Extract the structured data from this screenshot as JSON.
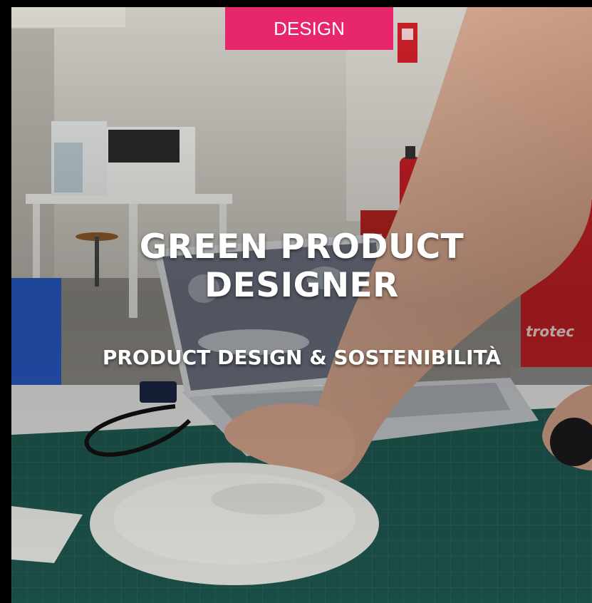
{
  "card": {
    "category": "DESIGN",
    "title_line1": "GREEN PRODUCT",
    "title_line2": "DESIGNER",
    "subtitle": "PRODUCT DESIGN & SOSTENIBILITÀ",
    "photo_caption_brand": "trotec"
  },
  "colors": {
    "badge": "#e8266b",
    "background": "#000000",
    "text": "#ffffff",
    "cutting_mat": "#1f5a52"
  }
}
